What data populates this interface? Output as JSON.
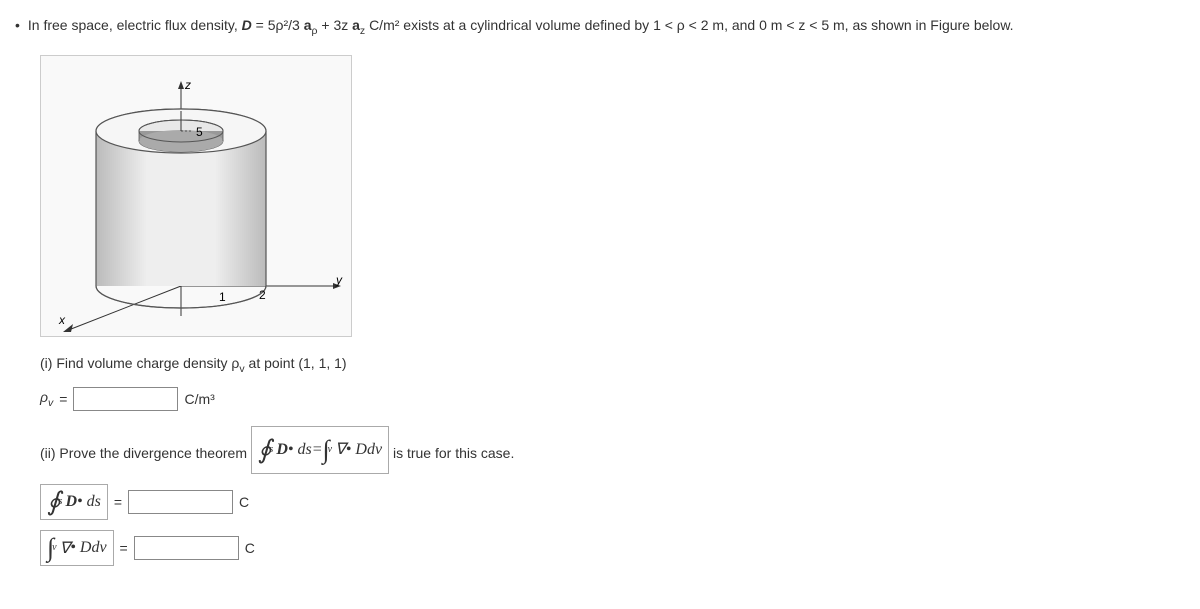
{
  "problem": {
    "bullet": "•",
    "statement": "In free space, electric flux density, ",
    "formula_D": "D",
    "equals": " = 5ρ²/3 ",
    "a_rho": "a",
    "rho_sub": "ρ",
    "plus_part": " + 3z ",
    "a_z": "a",
    "z_sub": "z",
    "units": " C/m²",
    "exists_text": " exists at a cylindrical volume defined by 1 < ρ < 2 m, and 0 m < z < 5 m, as shown in Figure below."
  },
  "figure": {
    "z_label": "z",
    "y_label": "y",
    "x_label": "x",
    "label_5": "5",
    "label_1": "1",
    "label_2": "2"
  },
  "q1": {
    "text": "(i) Find volume charge density ρ",
    "v_sub": "v",
    "text2": " at point (1, 1, 1)",
    "rho_label": "ρ",
    "v_sub2": "v",
    "equals": " = ",
    "units": "C/m³"
  },
  "q2": {
    "text": "(ii) Prove the divergence theorem ",
    "lhs_int": "∮",
    "lhs_D": "D",
    "dot_ds": " • ds",
    "eq": " = ",
    "rhs_int": "∫",
    "nabla": "∇",
    "dot_D": " • D",
    "dv": "dv",
    "text2": " is true for this case."
  },
  "ans2a": {
    "int": "∮",
    "D": "D",
    "dot_ds": " • ds",
    "equals": "=",
    "units": "C"
  },
  "ans2b": {
    "int": "∫",
    "nabla": "∇",
    "dot_D": " • D",
    "dv": "dv",
    "equals": "=",
    "units": "C"
  }
}
